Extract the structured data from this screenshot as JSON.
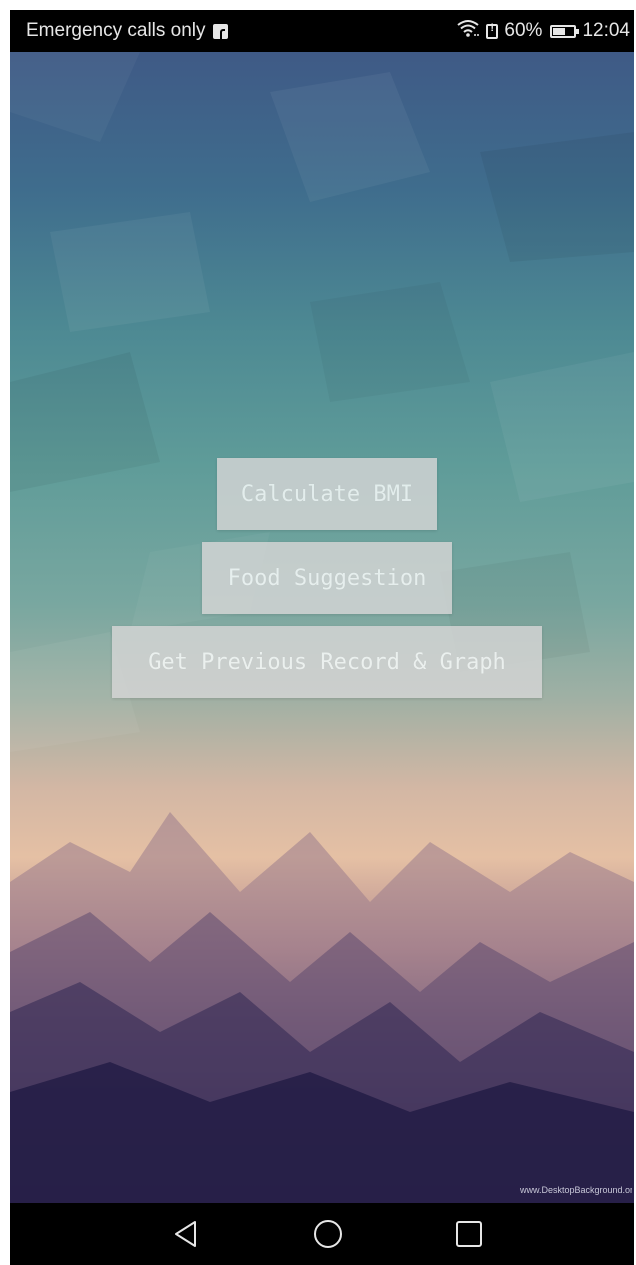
{
  "status_bar": {
    "carrier_text": "Emergency calls only",
    "notification_icon": "facebook-icon",
    "wifi_icon": "wifi-icon",
    "sim_icon": "sim-alert-icon",
    "battery_percent_text": "60%",
    "battery_level": 0.6,
    "time": "12:04"
  },
  "menu": {
    "calculate_bmi_label": "Calculate BMI",
    "food_suggestion_label": "Food Suggestion",
    "previous_record_label": "Get Previous Record & Graph"
  },
  "wallpaper": {
    "watermark": "www.DesktopBackground.org"
  },
  "nav_bar": {
    "back_icon": "back-triangle-icon",
    "home_icon": "home-circle-icon",
    "recents_icon": "recents-square-icon"
  },
  "colors": {
    "status_bar_bg": "#000000",
    "button_bg": "#d6d6d6",
    "button_text": "#ffffff",
    "nav_bar_bg": "#000000"
  }
}
